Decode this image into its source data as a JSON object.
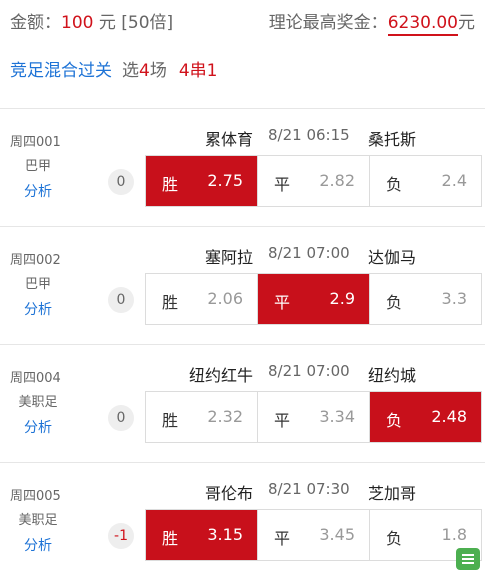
{
  "header": {
    "amount_label": "金额：",
    "amount_value": "100",
    "amount_unit": " 元 [50倍]",
    "max_prize_label": "理论最高奖金：",
    "max_prize_value": "6230.00",
    "max_prize_unit": "元"
  },
  "mode": {
    "game_name": "竞足混合过关",
    "select_prefix": "选",
    "select_count": "4",
    "select_suffix": "场",
    "pass_type": "4串1"
  },
  "option_labels": {
    "win": "胜",
    "draw": "平",
    "lose": "负"
  },
  "matches": [
    {
      "no": "周四001",
      "league": "巴甲",
      "analyze": "分析",
      "home": "累体育",
      "time": "8/21 06:15",
      "away": "桑托斯",
      "handicap": "0",
      "odds": {
        "win": "2.75",
        "draw": "2.82",
        "lose": "2.4"
      },
      "selected": "win"
    },
    {
      "no": "周四002",
      "league": "巴甲",
      "analyze": "分析",
      "home": "塞阿拉",
      "time": "8/21 07:00",
      "away": "达伽马",
      "handicap": "0",
      "odds": {
        "win": "2.06",
        "draw": "2.9",
        "lose": "3.3"
      },
      "selected": "draw"
    },
    {
      "no": "周四004",
      "league": "美职足",
      "analyze": "分析",
      "home": "纽约红牛",
      "time": "8/21 07:00",
      "away": "纽约城",
      "handicap": "0",
      "odds": {
        "win": "2.32",
        "draw": "3.34",
        "lose": "2.48"
      },
      "selected": "lose"
    },
    {
      "no": "周四005",
      "league": "美职足",
      "analyze": "分析",
      "home": "哥伦布",
      "time": "8/21 07:30",
      "away": "芝加哥",
      "handicap": "-1",
      "odds": {
        "win": "3.15",
        "draw": "3.45",
        "lose": "1.8"
      },
      "selected": "win"
    }
  ],
  "colors": {
    "accent_red": "#c8101b",
    "link_blue": "#1e73d6",
    "float_green": "#4caf50"
  },
  "icons": {
    "float_button": "document-list-icon"
  }
}
